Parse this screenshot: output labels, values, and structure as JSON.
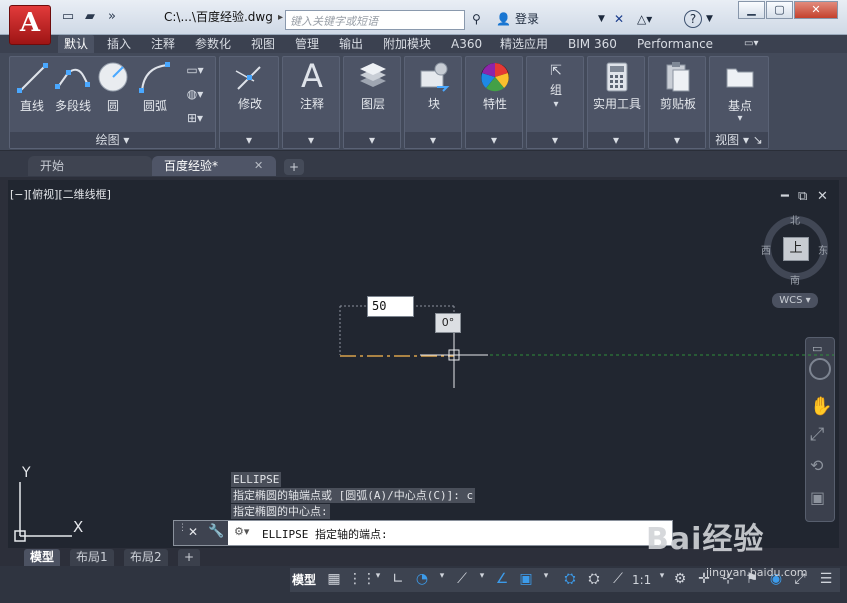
{
  "app": {
    "logo_letter": "A"
  },
  "title_bar": {
    "document_title": "C:\\...\\百度经验.dwg",
    "search_placeholder": "键入关键字或短语",
    "signin_label": "登录",
    "help_label": "?"
  },
  "ribbon_tabs": [
    "默认",
    "插入",
    "注释",
    "参数化",
    "视图",
    "管理",
    "输出",
    "附加模块",
    "A360",
    "精选应用",
    "BIM 360",
    "Performance"
  ],
  "ribbon_panels": {
    "draw": {
      "tools": [
        "直线",
        "多段线",
        "圆",
        "圆弧"
      ],
      "footer": "绘图"
    },
    "modify": {
      "label": "修改"
    },
    "annotation": {
      "label": "注释"
    },
    "layers": {
      "label": "图层"
    },
    "block": {
      "label": "块"
    },
    "properties": {
      "label": "特性"
    },
    "groups": {
      "label": "组"
    },
    "utilities": {
      "label": "实用工具"
    },
    "clipboard": {
      "label": "剪贴板"
    },
    "view": {
      "label": "基点",
      "footer": "视图"
    }
  },
  "file_tabs": [
    {
      "label": "开始",
      "active": false
    },
    {
      "label": "百度经验*",
      "active": true
    }
  ],
  "viewport": {
    "view_label": "[−][俯视][二维线框]",
    "viewcube_face": "上",
    "compass": {
      "north": "北",
      "south": "南",
      "east": "东",
      "west": "西"
    },
    "wcs_label": "WCS"
  },
  "dynamic_input": {
    "value": "50",
    "angle": "0°"
  },
  "command_history": [
    "ELLIPSE",
    "指定椭圆的轴端点或 [圆弧(A)/中心点(C)]: c",
    "指定椭圆的中心点:"
  ],
  "command_line": {
    "prompt": "ELLIPSE 指定轴的端点:"
  },
  "layout_tabs": [
    "模型",
    "布局1",
    "布局2"
  ],
  "status_bar": {
    "model_label": "模型",
    "scale_label": "1:1"
  },
  "ucs": {
    "x_label": "X",
    "y_label": "Y"
  },
  "watermark": {
    "brand": "Bai经验",
    "url": "jingyan.baidu.com"
  },
  "colors": {
    "accent_red": "#c62828",
    "canvas": "#212630",
    "active_status": "#3c9bea"
  }
}
